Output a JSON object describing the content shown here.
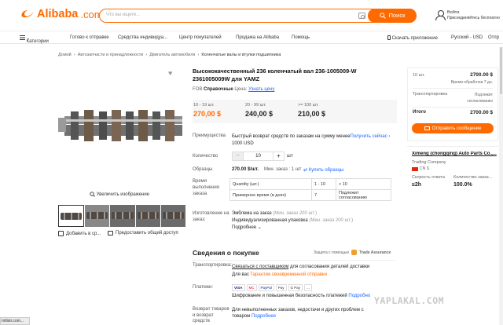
{
  "header": {
    "logo_text": "Alibaba",
    "logo_domain": ".com",
    "search_placeholder": "Что вы ищете...",
    "search_button": "Поиск",
    "user_line1": "Войти",
    "user_line2": "Присоединяйтесь бесплатно"
  },
  "nav": {
    "categories": "Категории",
    "items": [
      "Готово к отправке",
      "Средства индивидуа...",
      "Центр покупателей",
      "Продажа на Alibaba",
      "Помощь"
    ],
    "app": "Скачать приложение",
    "lang": "Русский - USD",
    "ship": "Отпр"
  },
  "breadcrumb": [
    "Домой",
    "Автозапчасти и принадлежности",
    "Двигатель автомобиля",
    "Коленчатые валы и втулки подшипника"
  ],
  "gallery": {
    "zoom_label": "Увеличить изображение",
    "add_compare": "Добавить в ср...",
    "share": "Предоставить общий доступ"
  },
  "product": {
    "title": "Высококачественный 236 коленчатый вал 236-1005009-W 2361005009W для YAMZ",
    "fob_label": "FOB",
    "fob_ref": "Справочные",
    "fob_price_word": "Цена:",
    "fob_link": "Узнать цену",
    "tiers": [
      {
        "qty": "10 - 19 шт.",
        "price": "270,00 $"
      },
      {
        "qty": "20 - 99 шт.",
        "price": "240,00 $"
      },
      {
        "qty": ">= 100 шт.",
        "price": "210,00 $"
      }
    ],
    "advantages_label": "Преимущества",
    "advantages_text": "Быстрый возврат средств по заказам на сумму менее",
    "advantages_amount": "1000 USD",
    "advantages_link": "Получить сейчас",
    "quantity_label": "Количество",
    "quantity_value": "10",
    "quantity_unit": "шт",
    "samples_label": "Образцы",
    "samples_price": "270.00 $/шт.",
    "samples_min": "Мин. заказ : 1 шт",
    "samples_buy": "Купить образцы",
    "leadtime_label": [
      "Время",
      "выполнения",
      "заказа"
    ],
    "leadtime_table": [
      [
        "Quantity (шт.)",
        "1 - 10",
        "> 10"
      ],
      [
        "Примерное время (в днях)",
        "7",
        "Подлежит согласованию"
      ]
    ],
    "custom_label": [
      "Изготовление на",
      "заказ:"
    ],
    "custom_items": [
      {
        "name": "Эмблема на заказ",
        "min": "(Мин. заказ 200 шт.)"
      },
      {
        "name": "Индивидуализированная упаковка",
        "min": "(Мин. заказ 200 шт.)"
      }
    ],
    "custom_more": "Подробнее"
  },
  "purchase": {
    "section_title": "Сведения о покупке",
    "protection_text": "Защита с помощью",
    "protection_brand": "Trade Assurance",
    "transport_label": "Транспортировка:",
    "transport_link": "Связаться с поставщиком",
    "transport_text": "для согласования деталей доставки",
    "transport_line2_pre": "Для вас",
    "transport_line2_link": "Гарантия своевременной отправки",
    "payments_label": "Платежи:",
    "payment_methods": [
      "VISA",
      "MC",
      "PayPal",
      "Pay",
      "G Pay",
      "..."
    ],
    "payments_text": "Шифрование и повышенная безопасность платежей",
    "payments_link": "Подробно",
    "returns_label": [
      "Возврат товаров",
      "и возврат",
      "средств"
    ],
    "returns_text1": "Для невыполненных заказов, недостачи и других проблем с",
    "returns_text2": "товаром",
    "returns_link": "Подробнее"
  },
  "sidebar": {
    "qty": "10 шт.",
    "price": "2700.00 $",
    "lead_time": "Время обработки 7 дн.",
    "transport_label": "Транспортировка",
    "transport_value_1": "Подлежит",
    "transport_value_2": "согласованию",
    "total_label": "Итого",
    "total_value": "2700.00 $",
    "message_button": "Отправить сообщение"
  },
  "supplier": {
    "name": "Ximeng (chongqing) Auto Parts Co.,...",
    "type": "Trading Company",
    "country": "CN",
    "years": "1",
    "stat1_label": "Скорость ответа",
    "stat1_value": "≤2h",
    "stat2_label": "Количество заказ...",
    "stat2_value": "100.0%"
  },
  "watermark": "YAPLAKAL.COM",
  "status_bar": "mtlistr.com...",
  "colors": {
    "accent": "#ff6a00",
    "link": "#1a66ff"
  }
}
